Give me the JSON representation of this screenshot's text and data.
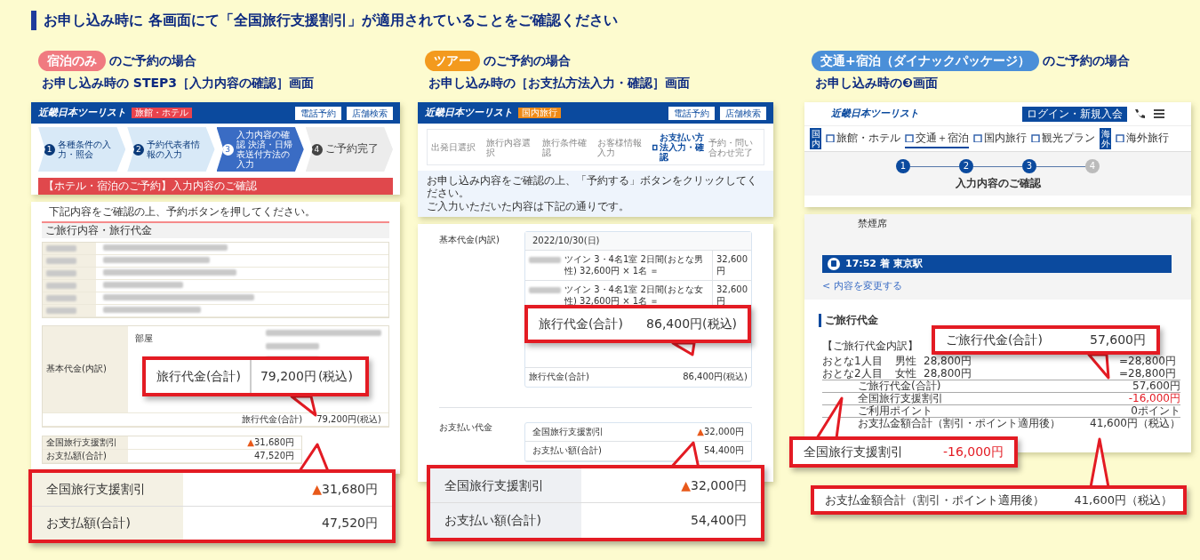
{
  "heading": "お申し込み時に 各画面にて「全国旅行支援割引」が適用されていることをご確認ください",
  "sections": [
    {
      "kind": "hotel",
      "tag": "宿泊のみ",
      "color": "#f07a80",
      "suffix": "のご予約の場合",
      "subtitle": "お申し込み時の STEP3［入力内容の確認］画面",
      "screen": {
        "logo": "近畿日本ツーリスト",
        "category": "旅館・ホテル",
        "buttons": [
          "電話予約",
          "店舗検索"
        ],
        "steps": [
          {
            "num": "1",
            "label": "各種条件の入力・照会",
            "selected": false,
            "disabled": false
          },
          {
            "num": "2",
            "label": "予約代表者情報の入力",
            "selected": false,
            "disabled": false
          },
          {
            "num": "3",
            "label": "入力内容の確認 決済・日帰表送付方法の入力",
            "selected": true,
            "disabled": false
          },
          {
            "num": "4",
            "label": "ご予約完了",
            "selected": false,
            "disabled": true
          }
        ],
        "page_title": "【ホテル・宿泊のご予約】入力内容のご確認",
        "intro": "下記内容をご確認の上、予約ボタンを押してください。",
        "section_title": "ご旅行内容・旅行代金",
        "price_label": "基本代金(内訳)",
        "room_label": "部屋",
        "total": {
          "label": "旅行代金(合計)",
          "value": "79,200円(税込)"
        },
        "payments": [
          {
            "label": "全国旅行支援割引",
            "mark": "▲",
            "value": "31,680円"
          },
          {
            "label": "お支払額(合計)",
            "value": "47,520円"
          }
        ]
      },
      "callouts": [
        {
          "kind": "pair",
          "label": "旅行代金(合計)",
          "value": "79,200円",
          "note": "(税込)"
        },
        {
          "kind": "table",
          "rows": [
            {
              "label": "全国旅行支援割引",
              "mark": "▲",
              "value": "31,680円"
            },
            {
              "label": "お支払額(合計)",
              "value": "47,520円"
            }
          ]
        }
      ]
    },
    {
      "kind": "tour",
      "tag": "ツアー",
      "color": "#f39a1e",
      "suffix": "のご予約の場合",
      "subtitle": "お申し込み時の［お支払方法入力・確認］画面",
      "screen": {
        "logo": "近畿日本ツーリスト",
        "category": "国内旅行",
        "buttons": [
          "電話予約",
          "店舗検索"
        ],
        "steps": [
          {
            "label": "出発日選択",
            "selected": false
          },
          {
            "label": "旅行内容選択",
            "selected": false
          },
          {
            "label": "旅行条件確認",
            "selected": false
          },
          {
            "label": "お客様情報入力",
            "selected": false
          },
          {
            "label": "お支払い方法入力・確認",
            "selected": true
          },
          {
            "label": "予約・問い合わせ完了",
            "selected": false
          }
        ],
        "message": "お申し込み内容をご確認の上、「予約する」ボタンをクリックしてください。",
        "note": "ご入力いただいた内容は下記の通りです。",
        "price_label": "基本代金(内訳)",
        "date": "2022/10/30(日)",
        "items": [
          {
            "text": "ツイン 3・4名1室 2日間(おとな男性) 32,600円 × 1名 ＝",
            "amount": "32,600円"
          },
          {
            "text": "ツイン 3・4名1室 2日間(おとな女性) 32,600円 × 1名 ＝",
            "amount": "32,600円"
          }
        ],
        "total": {
          "label": "旅行代金(合計)",
          "value": "86,400円(税込)"
        },
        "payment_label": "お支払い代金",
        "payments": [
          {
            "label": "全国旅行支援割引",
            "mark": "▲",
            "value": "32,000円"
          },
          {
            "label": "お支払い額(合計)",
            "value": "54,400円"
          }
        ]
      },
      "callouts": [
        {
          "kind": "pair",
          "label": "旅行代金(合計)",
          "value": "86,400円(税込)"
        },
        {
          "kind": "table",
          "rows": [
            {
              "label": "全国旅行支援割引",
              "mark": "▲",
              "value": "32,000円"
            },
            {
              "label": "お支払い額(合計)",
              "value": "54,400円"
            }
          ]
        }
      ]
    },
    {
      "kind": "dynamic",
      "tag": "交通+宿泊（ダイナックパッケージ）",
      "color": "#4a8fd8",
      "suffix": "のご予約の場合",
      "subtitle": "お申し込み時の❸画面",
      "screen": {
        "logo": "近畿日本ツーリスト",
        "login": "ログイン・新規入会",
        "nav": [
          {
            "kind": "region",
            "label": "国内"
          },
          {
            "kind": "link",
            "label": "旅館・ホテル",
            "selected": false
          },
          {
            "kind": "link",
            "label": "交通＋宿泊",
            "selected": true
          },
          {
            "kind": "link",
            "label": "国内旅行",
            "selected": false
          },
          {
            "kind": "link",
            "label": "観光プラン",
            "selected": false
          },
          {
            "kind": "region",
            "label": "海外"
          },
          {
            "kind": "link",
            "label": "海外旅行",
            "selected": false
          }
        ],
        "steps": [
          {
            "num": "1",
            "disabled": false
          },
          {
            "num": "2",
            "disabled": false
          },
          {
            "num": "3",
            "disabled": false
          },
          {
            "num": "4",
            "disabled": true
          }
        ],
        "step_title": "入力内容のご確認",
        "seat": "禁煙席",
        "arrival": "17:52 着 東京駅",
        "back_link": "< 内容を変更する",
        "price_title": "ご旅行代金",
        "breakdown_title": "【ご旅行代金内訳】",
        "people": [
          {
            "label": "おとな1人目",
            "gender": "男性",
            "price": "28,800円",
            "amount": "=28,800円"
          },
          {
            "label": "おとな2人目",
            "gender": "女性",
            "price": "28,800円",
            "amount": "=28,800円"
          }
        ],
        "summary": [
          {
            "label": "ご旅行代金(合計)",
            "value": "57,600円",
            "discount": false
          },
          {
            "label": "全国旅行支援割引",
            "value": "-16,000円",
            "discount": true
          },
          {
            "label": "ご利用ポイント",
            "value": "0ポイント",
            "discount": false
          },
          {
            "label": "お支払金額合計（割引・ポイント適用後）",
            "value": "41,600円（税込）",
            "discount": false
          }
        ]
      },
      "callouts": [
        {
          "kind": "pair",
          "label": "ご旅行代金(合計)",
          "value": "57,600円",
          "discount": false
        },
        {
          "kind": "pair",
          "label": "全国旅行支援割引",
          "value": "-16,000円",
          "discount": true
        },
        {
          "kind": "pair",
          "label": "お支払金額合計（割引・ポイント適用後）",
          "value": "41,600円（税込）",
          "discount": false
        }
      ]
    }
  ]
}
